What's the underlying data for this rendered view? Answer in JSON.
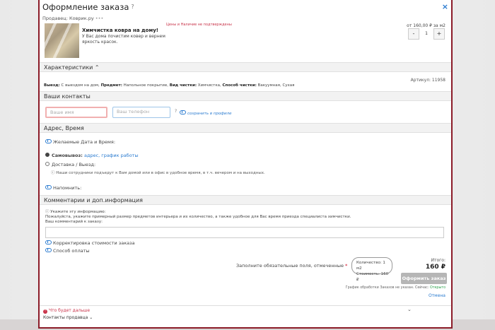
{
  "modal": {
    "title": "Оформление заказа",
    "title_help": "?",
    "close": "×",
    "seller": "Продавец: Коврик.ру",
    "seller_dots": "•••"
  },
  "product": {
    "price_note": "Цены и Наличие не подтверждены",
    "name": "Химчистка ковра на дому!",
    "desc": "У Вас дома почистим ковер и вернем яркость красок.",
    "unit_price": "от 160,00 ₽ за м2",
    "qty_minus": "-",
    "qty_value": "1",
    "qty_plus": "+",
    "image_icon": "carpet-photo"
  },
  "characteristics": {
    "header": "Характеристики ⌃",
    "article": "Артикул: 11958",
    "attrs": [
      {
        "k": "Выезд:",
        "v": "С выездом на дом,"
      },
      {
        "k": "Предмет:",
        "v": "Напольное покрытие,"
      },
      {
        "k": "Вид чистки:",
        "v": "Химчистка,"
      },
      {
        "k": "Способ чистки:",
        "v": "Вакуумная, Сухая"
      }
    ]
  },
  "contacts": {
    "header": "Ваши контакты",
    "name_placeholder": "Ваше имя",
    "phone_placeholder": "Ваш телефон",
    "phone_help": "?",
    "save_link": "сохранить в профиле"
  },
  "address": {
    "header": "Адрес, Время",
    "desired_date": "Желаемые Дата и Время:",
    "pickup_label": "Самовывоз:",
    "pickup_link": "адрес, график работы",
    "delivery_label": "Доставка / Выезд:",
    "delivery_note": "Наши сотрудники подъедут к Вам домой или в офис в удобное время, в т.ч. вечером и на выходных.",
    "remind": "Напомнить:"
  },
  "comments": {
    "header": "Комментарии и доп.информация",
    "hint_title": "Укажите эту информацию:",
    "hint_body": "Пожалуйста, укажите примерный размер предметов интерьера и их количество, а также удобное для Вас время приезда специалиста химчистки.",
    "your_comment": "Ваш комментарий к заказу:",
    "price_adjust": "Корректировка стоимости заказа",
    "payment": "Способ оплаты"
  },
  "footer": {
    "required_note": "Заполните обязательные поля, отмеченные",
    "required_star": "*",
    "qty_line": "Количество: 1 м2",
    "cost_line": "Стоимость: 160 ₽",
    "total_label": "Итого:",
    "total_value": "160 ₽",
    "order_button": "Оформить заказ",
    "schedule_text": "График обработки Заказов не указан. Сейчас:",
    "schedule_status": "Открыто",
    "cancel": "Отмена",
    "warning": "Что будет дальше",
    "warning_icon": "!",
    "chevron": "⌄",
    "seller_contacts": "Контакты продавца ⌄"
  },
  "colors": {
    "accent": "#2a7bd0",
    "modal_border": "#8b1b28",
    "error": "#c9344a"
  }
}
